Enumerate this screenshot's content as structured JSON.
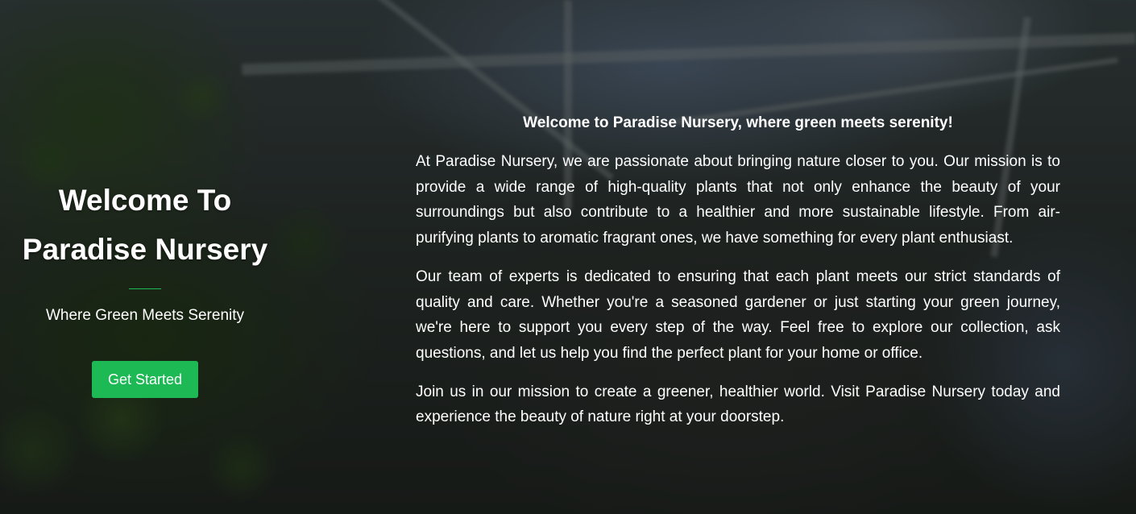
{
  "hero": {
    "title_line1": "Welcome To",
    "title_line2": "Paradise Nursery",
    "tagline": "Where Green Meets Serenity",
    "cta_label": "Get Started"
  },
  "about": {
    "heading": "Welcome to Paradise Nursery, where green meets serenity!",
    "paragraphs": [
      "At Paradise Nursery, we are passionate about bringing nature closer to you. Our mission is to provide a wide range of high-quality plants that not only enhance the beauty of your surroundings but also contribute to a healthier and more sustainable lifestyle. From air-purifying plants to aromatic fragrant ones, we have something for every plant enthusiast.",
      "Our team of experts is dedicated to ensuring that each plant meets our strict standards of quality and care. Whether you're a seasoned gardener or just starting your green journey, we're here to support you every step of the way. Feel free to explore our collection, ask questions, and let us help you find the perfect plant for your home or office.",
      "Join us in our mission to create a greener, healthier world. Visit Paradise Nursery today and experience the beauty of nature right at your doorstep."
    ]
  },
  "colors": {
    "accent": "#1db954",
    "text": "#ffffff",
    "overlay": "rgba(0,0,0,0.48)"
  }
}
